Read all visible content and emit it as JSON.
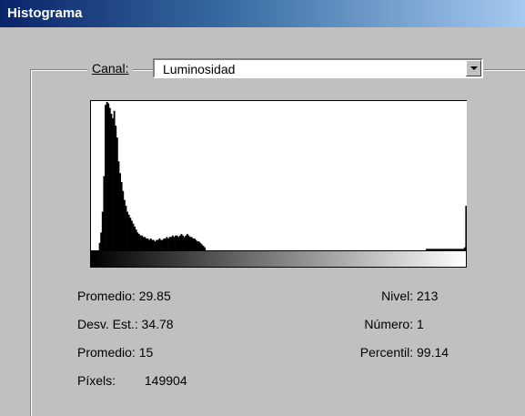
{
  "window": {
    "title": "Histograma"
  },
  "canal": {
    "label": "Canal:",
    "selected": "Luminosidad"
  },
  "histogram": {
    "heights": [
      0.0,
      0.0,
      0.0,
      0.0,
      0.0,
      0.0,
      0.05,
      0.12,
      0.26,
      0.5,
      0.98,
      1.0,
      0.99,
      0.96,
      0.92,
      0.89,
      0.94,
      0.84,
      0.76,
      0.6,
      0.52,
      0.46,
      0.4,
      0.34,
      0.3,
      0.26,
      0.24,
      0.22,
      0.2,
      0.18,
      0.16,
      0.14,
      0.12,
      0.11,
      0.1,
      0.1,
      0.09,
      0.09,
      0.08,
      0.08,
      0.07,
      0.08,
      0.07,
      0.07,
      0.06,
      0.07,
      0.07,
      0.08,
      0.07,
      0.07,
      0.08,
      0.08,
      0.09,
      0.08,
      0.09,
      0.09,
      0.1,
      0.09,
      0.1,
      0.1,
      0.09,
      0.1,
      0.11,
      0.1,
      0.09,
      0.1,
      0.11,
      0.1,
      0.09,
      0.09,
      0.08,
      0.08,
      0.07,
      0.06,
      0.06,
      0.05,
      0.04,
      0.03,
      0.02,
      0.0,
      0.0,
      0.0,
      0.0,
      0.0,
      0.0,
      0.0,
      0.0,
      0.0,
      0.0,
      0.0,
      0.0,
      0.0,
      0.0,
      0.0,
      0.0,
      0.0,
      0.0,
      0.0,
      0.0,
      0.0,
      0.0,
      0.0,
      0.0,
      0.0,
      0.0,
      0.0,
      0.0,
      0.0,
      0.0,
      0.0,
      0.0,
      0.0,
      0.0,
      0.0,
      0.0,
      0.0,
      0.0,
      0.0,
      0.0,
      0.0,
      0.0,
      0.0,
      0.0,
      0.0,
      0.0,
      0.0,
      0.0,
      0.0,
      0.0,
      0.0,
      0.0,
      0.0,
      0.0,
      0.0,
      0.0,
      0.0,
      0.0,
      0.0,
      0.0,
      0.0,
      0.0,
      0.0,
      0.0,
      0.0,
      0.0,
      0.0,
      0.0,
      0.0,
      0.0,
      0.0,
      0.0,
      0.0,
      0.0,
      0.0,
      0.0,
      0.0,
      0.0,
      0.0,
      0.0,
      0.0,
      0.0,
      0.0,
      0.0,
      0.0,
      0.0,
      0.0,
      0.0,
      0.0,
      0.0,
      0.0,
      0.0,
      0.0,
      0.0,
      0.0,
      0.0,
      0.0,
      0.0,
      0.0,
      0.0,
      0.0,
      0.0,
      0.0,
      0.0,
      0.0,
      0.0,
      0.0,
      0.0,
      0.0,
      0.0,
      0.0,
      0.0,
      0.0,
      0.0,
      0.0,
      0.0,
      0.0,
      0.0,
      0.0,
      0.0,
      0.0,
      0.0,
      0.0,
      0.0,
      0.0,
      0.0,
      0.0,
      0.0,
      0.0,
      0.0,
      0.0,
      0.0,
      0.0,
      0.0,
      0.0,
      0.0,
      0.0,
      0.0,
      0.0,
      0.0,
      0.0,
      0.0,
      0.0,
      0.0,
      0.0,
      0.0,
      0.0,
      0.0,
      0.0,
      0.0,
      0.0,
      0.01,
      0.01,
      0.01,
      0.01,
      0.01,
      0.01,
      0.01,
      0.01,
      0.01,
      0.01,
      0.01,
      0.01,
      0.01,
      0.01,
      0.01,
      0.01,
      0.01,
      0.01,
      0.01,
      0.01,
      0.01,
      0.01,
      0.01,
      0.01,
      0.01,
      0.01,
      0.02,
      0.3
    ]
  },
  "stats": {
    "promedio": {
      "label": "Promedio:",
      "value": "29.85"
    },
    "desv": {
      "label": "Desv. Est.:",
      "value": "34.78"
    },
    "mediana": {
      "label": "Promedio:",
      "value": "15"
    },
    "pixels": {
      "label": "Píxels:",
      "value": "149904"
    },
    "nivel": {
      "label": "Nivel:",
      "value": "213"
    },
    "numero": {
      "label": "Número:",
      "value": "1"
    },
    "percentil": {
      "label": "Percentil:",
      "value": "99.14"
    }
  }
}
